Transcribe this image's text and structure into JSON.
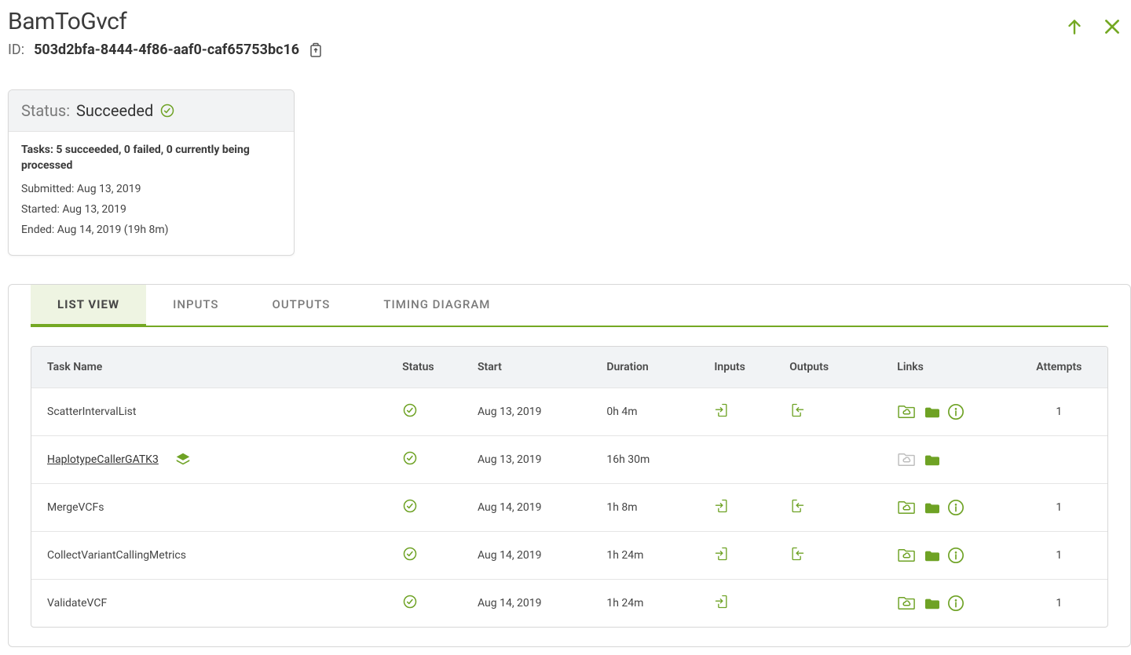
{
  "header": {
    "title": "BamToGvcf",
    "id_label": "ID:",
    "id_value": "503d2bfa-8444-4f86-aaf0-caf65753bc16"
  },
  "status": {
    "label": "Status:",
    "value": "Succeeded",
    "tasks_summary": "Tasks: 5 succeeded, 0 failed, 0 currently being processed",
    "submitted": "Submitted: Aug 13, 2019",
    "started": "Started: Aug 13, 2019",
    "ended": "Ended: Aug 14, 2019 (19h 8m)"
  },
  "tabs": [
    {
      "label": "LIST VIEW",
      "active": true
    },
    {
      "label": "INPUTS",
      "active": false
    },
    {
      "label": "OUTPUTS",
      "active": false
    },
    {
      "label": "TIMING DIAGRAM",
      "active": false
    }
  ],
  "columns": {
    "task": "Task Name",
    "status": "Status",
    "start": "Start",
    "duration": "Duration",
    "inputs": "Inputs",
    "outputs": "Outputs",
    "links": "Links",
    "attempts": "Attempts"
  },
  "rows": [
    {
      "task": "ScatterIntervalList",
      "is_link": false,
      "stacked": false,
      "start": "Aug 13, 2019",
      "duration": "0h 4m",
      "has_inputs": true,
      "has_outputs": true,
      "links": {
        "cloud": true,
        "cloud_enabled": true,
        "folder": true,
        "folder_enabled": true,
        "info": true
      },
      "attempts": "1"
    },
    {
      "task": "HaplotypeCallerGATK3",
      "is_link": true,
      "stacked": true,
      "start": "Aug 13, 2019",
      "duration": "16h 30m",
      "has_inputs": false,
      "has_outputs": false,
      "links": {
        "cloud": true,
        "cloud_enabled": false,
        "folder": true,
        "folder_enabled": true,
        "info": false
      },
      "attempts": ""
    },
    {
      "task": "MergeVCFs",
      "is_link": false,
      "stacked": false,
      "start": "Aug 14, 2019",
      "duration": "1h 8m",
      "has_inputs": true,
      "has_outputs": true,
      "links": {
        "cloud": true,
        "cloud_enabled": true,
        "folder": true,
        "folder_enabled": true,
        "info": true
      },
      "attempts": "1"
    },
    {
      "task": "CollectVariantCallingMetrics",
      "is_link": false,
      "stacked": false,
      "start": "Aug 14, 2019",
      "duration": "1h 24m",
      "has_inputs": true,
      "has_outputs": true,
      "links": {
        "cloud": true,
        "cloud_enabled": true,
        "folder": true,
        "folder_enabled": true,
        "info": true
      },
      "attempts": "1"
    },
    {
      "task": "ValidateVCF",
      "is_link": false,
      "stacked": false,
      "start": "Aug 14, 2019",
      "duration": "1h 24m",
      "has_inputs": true,
      "has_outputs": false,
      "links": {
        "cloud": true,
        "cloud_enabled": true,
        "folder": true,
        "folder_enabled": true,
        "info": true
      },
      "attempts": "1"
    }
  ]
}
